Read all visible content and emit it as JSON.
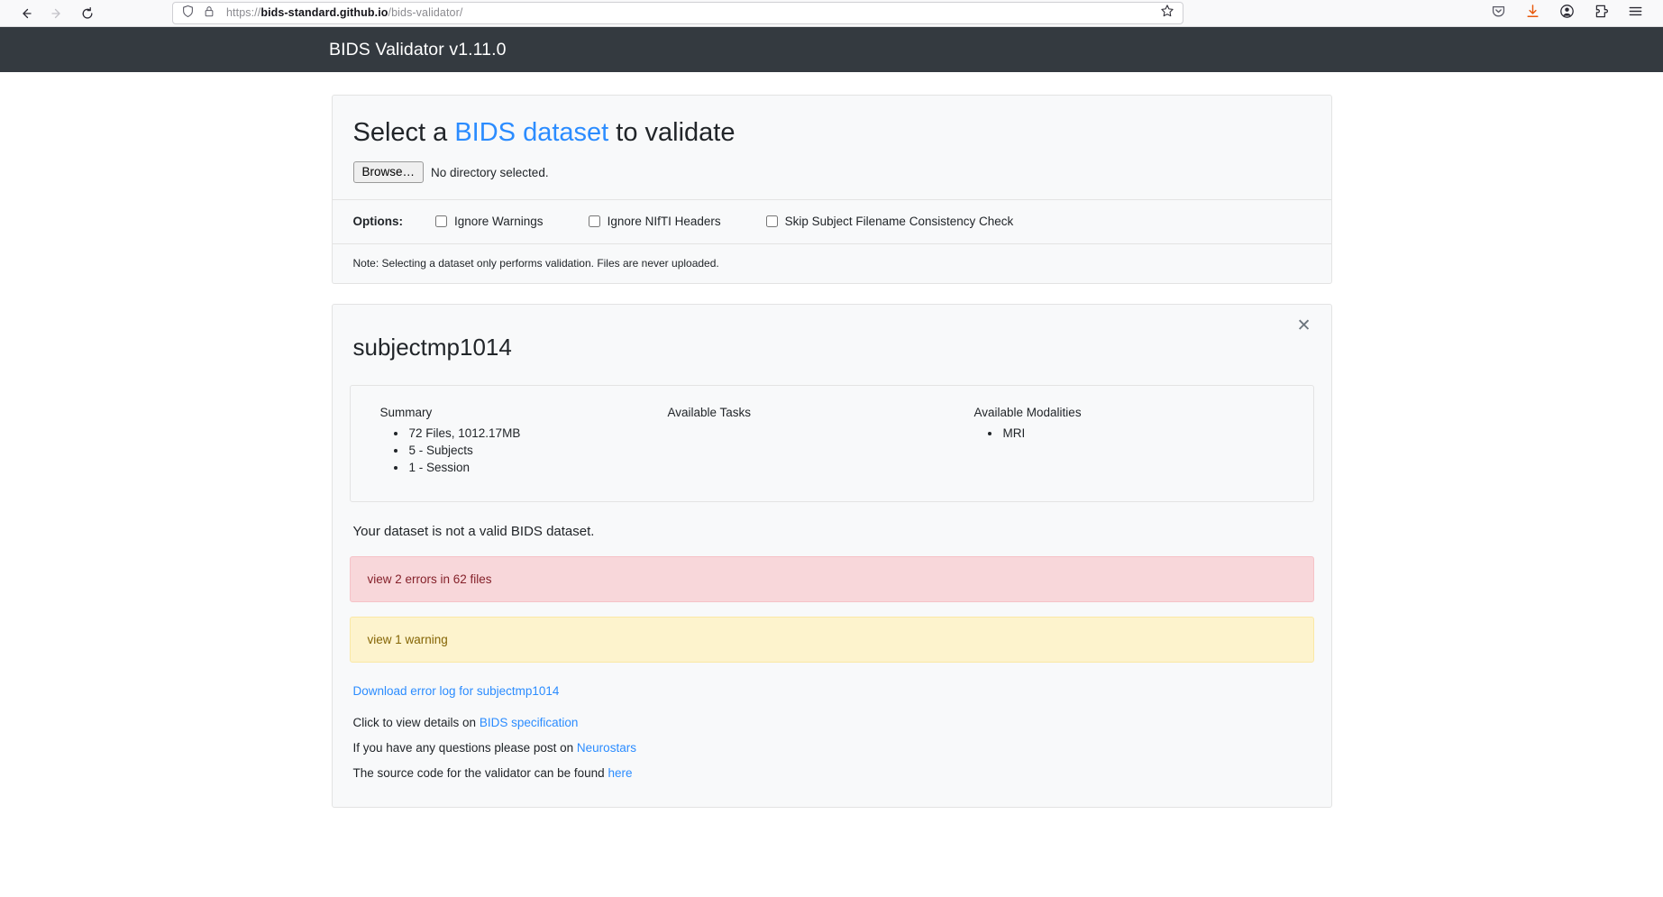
{
  "browser": {
    "nav": {
      "back_icon": "back-arrow-icon",
      "forward_icon": "forward-arrow-icon",
      "reload_icon": "reload-icon"
    },
    "url": {
      "scheme": "https://",
      "host": "bids-standard.github.io",
      "path": "/bids-validator/",
      "shield_icon": "shield-icon",
      "lock_icon": "padlock-icon",
      "bookmark_icon": "star-icon"
    },
    "toolbar_icons": [
      "pocket-icon",
      "downloads-icon",
      "account-icon",
      "extensions-icon",
      "app-menu-icon"
    ],
    "accent_download": "#e8590c"
  },
  "app": {
    "title": "BIDS Validator v1.11.0",
    "navbar_color": "#343a40"
  },
  "select_card": {
    "title_pre": "Select a ",
    "title_link": "BIDS dataset",
    "title_post": " to validate",
    "browse_label": "Browse…",
    "browse_status": "No directory selected.",
    "options_label": "Options:",
    "options": [
      {
        "label": "Ignore Warnings",
        "checked": false
      },
      {
        "label": "Ignore NIfTI Headers",
        "checked": false
      },
      {
        "label": "Skip Subject Filename Consistency Check",
        "checked": false
      }
    ],
    "note": "Note: Selecting a dataset only performs validation. Files are never uploaded."
  },
  "results": {
    "close_label": "✕",
    "dataset_name": "subjectmp1014",
    "columns": [
      {
        "heading": "Summary",
        "items": [
          "72 Files, 1012.17MB",
          "5 - Subjects",
          "1 - Session"
        ]
      },
      {
        "heading": "Available Tasks",
        "items": []
      },
      {
        "heading": "Available Modalities",
        "items": [
          "MRI"
        ]
      }
    ],
    "validity_message": "Your dataset is not a valid BIDS dataset.",
    "errors_banner": {
      "label": "view 2 errors in 62 files",
      "color": "#f8d7da"
    },
    "warnings_banner": {
      "label": "view 1 warning",
      "color": "#fdf3cd"
    },
    "download_log_label": "Download error log for subjectmp1014",
    "footer": [
      {
        "pre": "Click to view details on ",
        "link": "BIDS specification",
        "post": ""
      },
      {
        "pre": "If you have any questions please post on ",
        "link": "Neurostars",
        "post": ""
      },
      {
        "pre": "The source code for the validator can be found ",
        "link": "here",
        "post": ""
      }
    ]
  }
}
